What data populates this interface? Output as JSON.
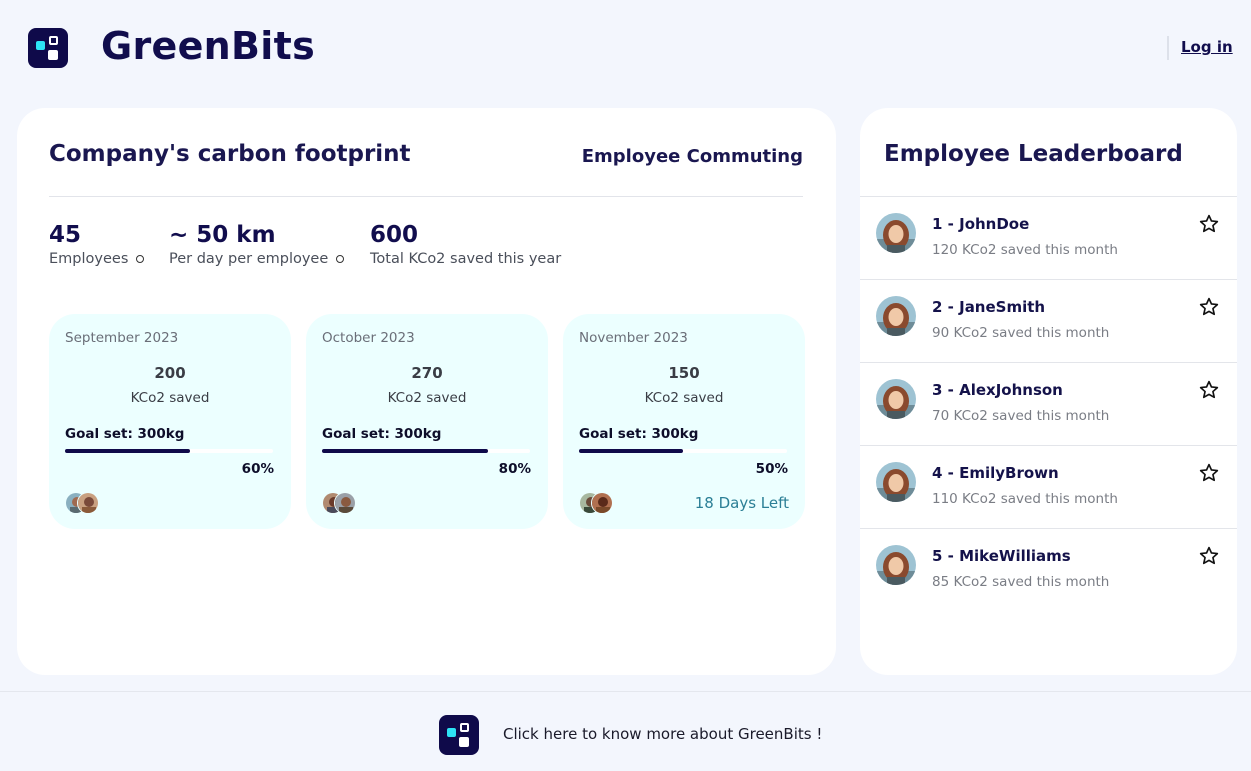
{
  "header": {
    "brand": "GreenBits",
    "login_label": "Log in"
  },
  "footprint": {
    "title": "Company's carbon footprint",
    "subtitle": "Employee Commuting",
    "stats": [
      {
        "value": "45",
        "label": "Employees"
      },
      {
        "value": "~ 50 km",
        "label": "Per day per employee"
      },
      {
        "value": "600",
        "label": "Total KCo2 saved this year"
      }
    ],
    "months": [
      {
        "name": "September 2023",
        "saved": "200",
        "unit": "KCo2 saved",
        "goal": "Goal set: 300kg",
        "progress": 60,
        "percent": "60%",
        "days_left": ""
      },
      {
        "name": "October 2023",
        "saved": "270",
        "unit": "KCo2 saved",
        "goal": "Goal set: 300kg",
        "progress": 80,
        "percent": "80%",
        "days_left": ""
      },
      {
        "name": "November 2023",
        "saved": "150",
        "unit": "KCo2 saved",
        "goal": "Goal set: 300kg",
        "progress": 50,
        "percent": "50%",
        "days_left": "18 Days Left"
      }
    ]
  },
  "leaderboard": {
    "title": "Employee Leaderboard",
    "entries": [
      {
        "name": "1 - JohnDoe",
        "saved": "120 KCo2 saved this month"
      },
      {
        "name": "2 - JaneSmith",
        "saved": "90 KCo2 saved this month"
      },
      {
        "name": "3 - AlexJohnson",
        "saved": "70 KCo2 saved this month"
      },
      {
        "name": "4 - EmilyBrown",
        "saved": "110 KCo2 saved this month"
      },
      {
        "name": "5 - MikeWilliams",
        "saved": "85 KCo2 saved this month"
      }
    ]
  },
  "footer": {
    "link_text": "Click here to know more about GreenBits !"
  },
  "colors": {
    "brand_navy": "#0f0a4a",
    "accent_cyan": "#2de3f5",
    "card_tint": "#ecffff",
    "page_bg": "#f3f6fd"
  },
  "icons": [
    "greenbits-logo-icon",
    "info-circle-icon",
    "star-icon",
    "avatar-photo"
  ]
}
